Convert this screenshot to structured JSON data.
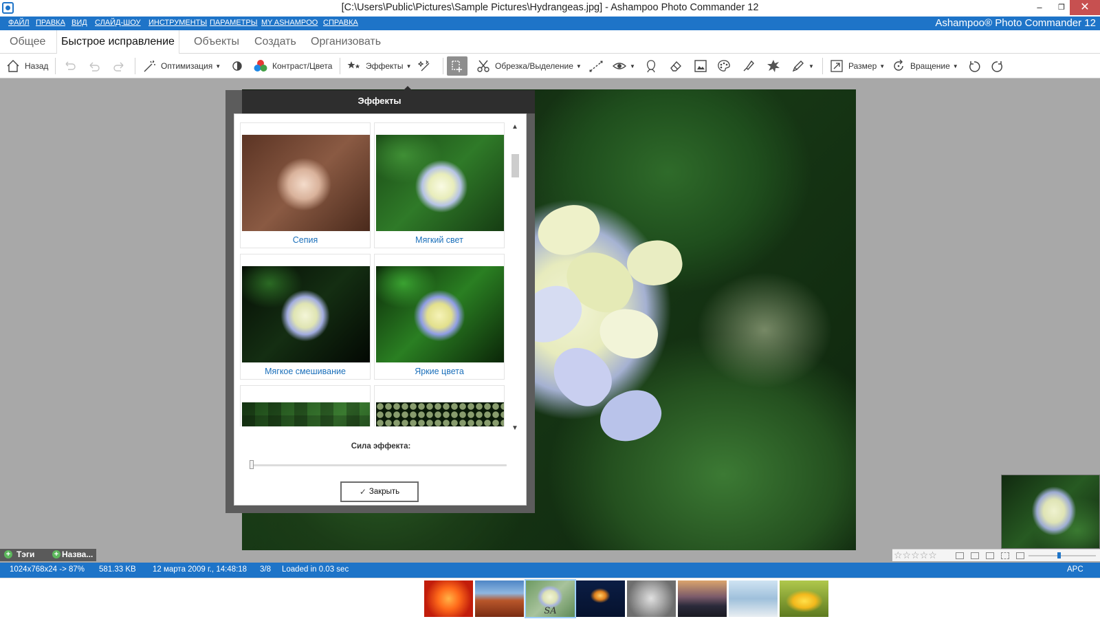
{
  "window": {
    "title": "[C:\\Users\\Public\\Pictures\\Sample Pictures\\Hydrangeas.jpg] - Ashampoo Photo Commander 12",
    "minimize": "‒",
    "restore": "❐",
    "close": "✕"
  },
  "menu": {
    "items": [
      "ФАЙЛ",
      "ПРАВКА",
      "ВИД",
      "СЛАЙД-ШОУ",
      "ИНСТРУМЕНТЫ",
      "ПАРАМЕТРЫ",
      "MY ASHAMPOO",
      "СПРАВКА"
    ],
    "brand": "Ashampoo® Photo Commander 12"
  },
  "tabs": [
    "Общее",
    "Быстрое исправление",
    "Объекты",
    "Создать",
    "Организовать"
  ],
  "toolbar": {
    "back": "Назад",
    "optimize": "Оптимизация",
    "contrast": "Контраст/Цвета",
    "effects": "Эффекты",
    "crop": "Обрезка/Выделение",
    "size": "Размер",
    "rotate": "Вращение"
  },
  "dialog": {
    "title": "Эффекты",
    "effects": [
      "Сепия",
      "Мягкий свет",
      "Мягкое смешивание",
      "Яркие цвета"
    ],
    "strength_label": "Сила эффекта:",
    "strength": 0,
    "close": "Закрыть"
  },
  "tagbar": {
    "tags": "Тэги",
    "names": "Назва..."
  },
  "rating": {
    "stars": "☆☆☆☆☆"
  },
  "status": {
    "dimensions": "1024x768x24 -> 87%",
    "filesize": "581.33 KB",
    "date": "12 марта 2009 г., 14:48:18",
    "index": "3/8",
    "loaded": "Loaded in 0.03 sec",
    "lang": "APC"
  },
  "filmstrip": {
    "selected_label": "SA"
  },
  "colors": {
    "accent": "#1e74c8",
    "link": "#1a6fba",
    "dialog_header": "#2e2e2e"
  }
}
